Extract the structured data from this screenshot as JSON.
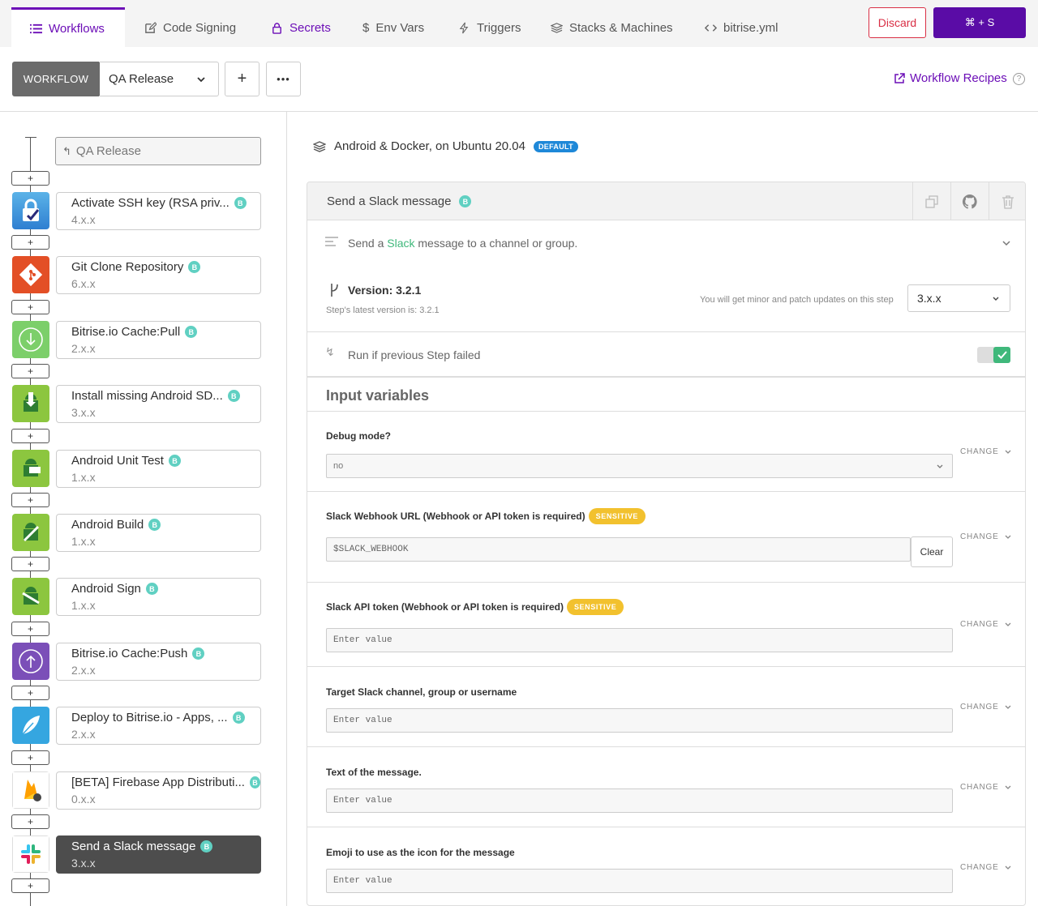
{
  "tabs": [
    {
      "label": "Workflows",
      "icon": "list-icon"
    },
    {
      "label": "Code Signing",
      "icon": "edit-icon"
    },
    {
      "label": "Secrets",
      "icon": "lock-icon"
    },
    {
      "label": "Env Vars",
      "icon": "dollar-icon"
    },
    {
      "label": "Triggers",
      "icon": "bolt-icon"
    },
    {
      "label": "Stacks & Machines",
      "icon": "layers-icon"
    },
    {
      "label": "bitrise.yml",
      "icon": "code-icon"
    }
  ],
  "actions": {
    "discard": "Discard",
    "save": "⌘ + S"
  },
  "workflow": {
    "label": "WORKFLOW",
    "selected": "QA Release",
    "recipes": "Workflow Recipes",
    "trigger": "QA Release",
    "add": "+",
    "more": "•••"
  },
  "steps": [
    {
      "name": "Activate SSH key (RSA priv...",
      "version": "4.x.x",
      "icon": "ssh-lock-icon"
    },
    {
      "name": "Git Clone Repository",
      "version": "6.x.x",
      "icon": "git-icon"
    },
    {
      "name": "Bitrise.io Cache:Pull",
      "version": "2.x.x",
      "icon": "cache-pull-icon"
    },
    {
      "name": "Install missing Android SD...",
      "version": "3.x.x",
      "icon": "android-install-icon"
    },
    {
      "name": "Android Unit Test",
      "version": "1.x.x",
      "icon": "android-test-icon"
    },
    {
      "name": "Android Build",
      "version": "1.x.x",
      "icon": "android-build-icon"
    },
    {
      "name": "Android Sign",
      "version": "1.x.x",
      "icon": "android-sign-icon"
    },
    {
      "name": "Bitrise.io Cache:Push",
      "version": "2.x.x",
      "icon": "cache-push-icon"
    },
    {
      "name": "Deploy to Bitrise.io - Apps, ...",
      "version": "2.x.x",
      "icon": "deploy-icon"
    },
    {
      "name": "[BETA] Firebase App Distributi...",
      "version": "0.x.x",
      "icon": "firebase-icon"
    },
    {
      "name": "Send a Slack message",
      "version": "3.x.x",
      "icon": "slack-icon"
    }
  ],
  "badge": "B",
  "plus": "+",
  "stack": {
    "name": "Android & Docker, on Ubuntu 20.04",
    "badge": "DEFAULT"
  },
  "step_detail": {
    "title": "Send a Slack message",
    "desc_pre": "Send a ",
    "desc_link": "Slack",
    "desc_post": " message to a channel or group.",
    "version_label": "Version: 3.2.1",
    "latest": "Step's latest version is: 3.2.1",
    "update_note": "You will get minor and patch updates on this step",
    "version_select": "3.x.x",
    "run_if": "Run if previous Step failed",
    "run_if_enabled": true,
    "inputs_title": "Input variables",
    "change": "CHANGE",
    "sensitive": "SENSITIVE",
    "clear": "Clear",
    "inputs": [
      {
        "label": "Debug mode?",
        "value": "no"
      },
      {
        "label": "Slack Webhook URL (Webhook or API token is required)",
        "value": "$SLACK_WEBHOOK"
      },
      {
        "label": "Slack API token (Webhook or API token is required)",
        "placeholder": "Enter value"
      },
      {
        "label": "Target Slack channel, group or username",
        "placeholder": "Enter value"
      },
      {
        "label": "Text of the message.",
        "placeholder": "Enter value"
      },
      {
        "label": "Emoji to use as the icon for the message",
        "placeholder": "Enter value"
      }
    ]
  },
  "colors": {
    "accent": "#6c0eb7",
    "danger": "#d92f45",
    "badge": "#60d0c2",
    "sensitive": "#f2c12e",
    "toggle": "#3fb87b"
  }
}
